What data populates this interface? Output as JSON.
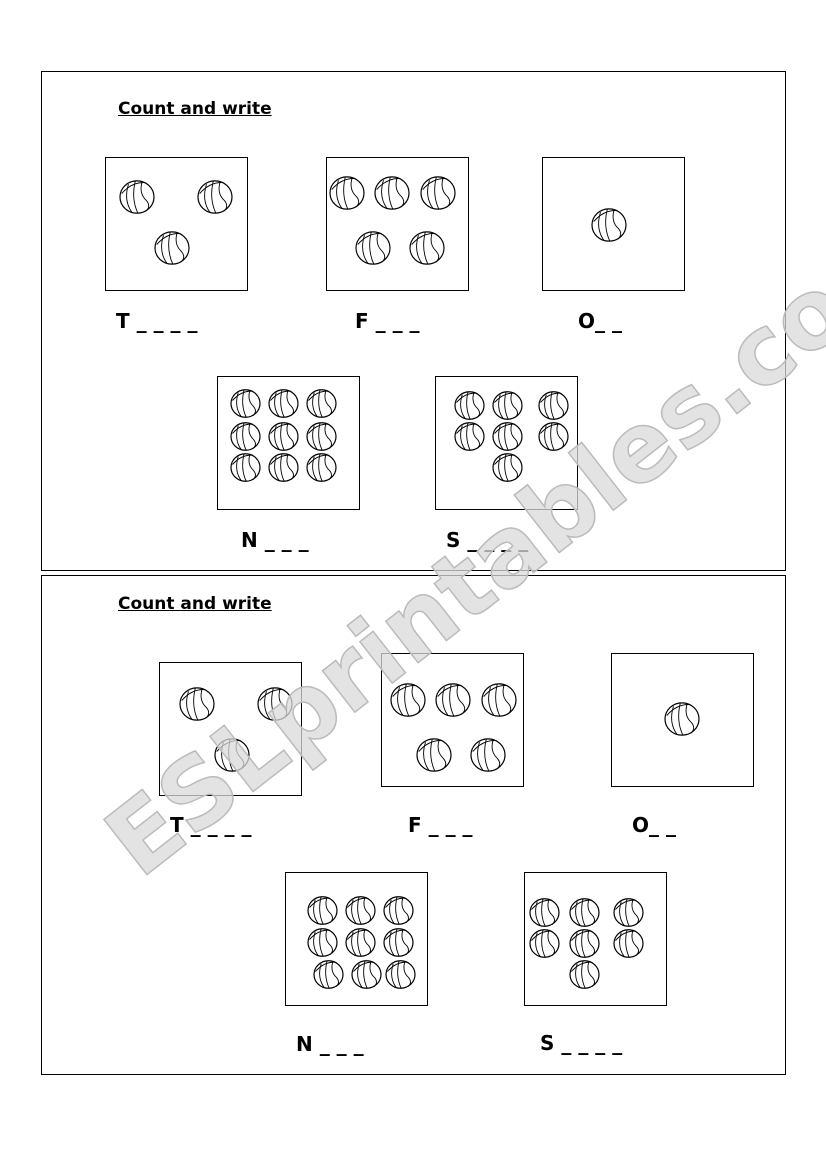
{
  "watermark": "ESLprintables.com",
  "sections": [
    {
      "title": "Count and write",
      "labels": [
        "T _ _ _ _",
        "F _ _ _",
        "O_ _",
        "N _ _ _",
        "S _ _ _ _"
      ],
      "ball_counts": [
        3,
        5,
        1,
        9,
        7
      ]
    },
    {
      "title": "Count and write",
      "labels": [
        "T _ _ _ _",
        "F _ _ _",
        "O_ _",
        "N _ _ _",
        "S _ _ _ _"
      ],
      "ball_counts": [
        3,
        5,
        1,
        9,
        7
      ]
    }
  ],
  "ball_icon": "basketball-icon"
}
